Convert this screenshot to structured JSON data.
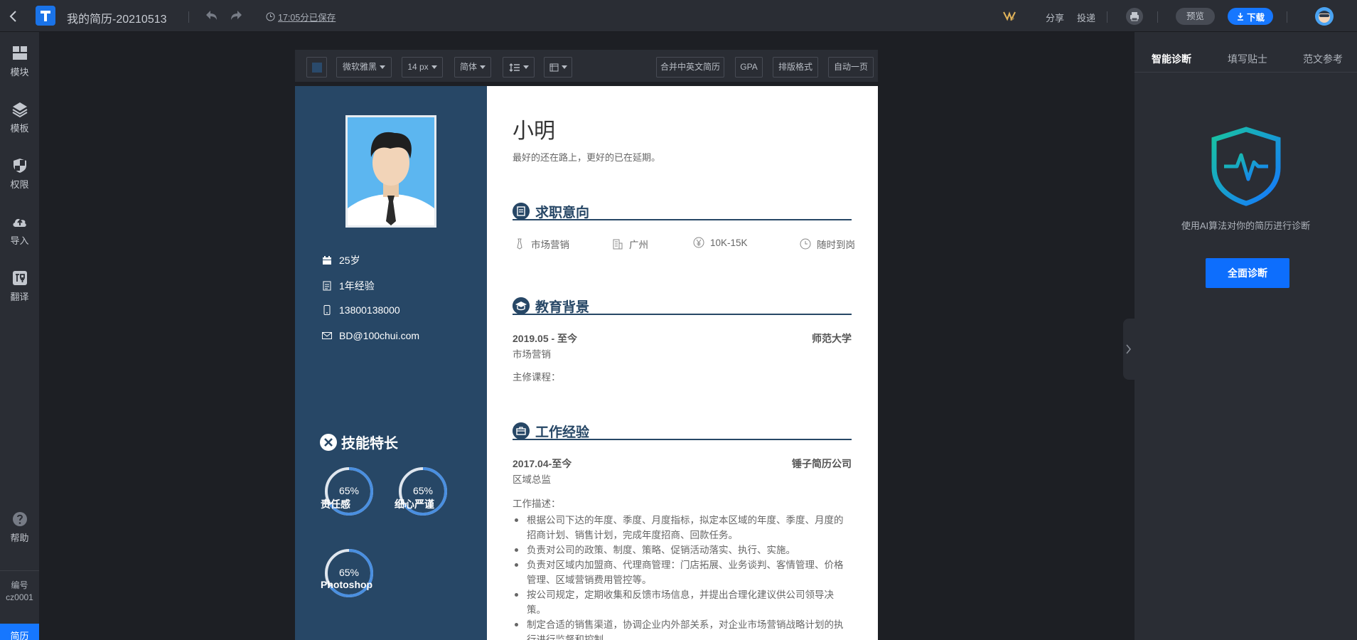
{
  "topbar": {
    "doc_title": "我的简历-20210513",
    "save_status": "17:05分已保存",
    "share": "分享",
    "deliver": "投递",
    "preview": "预览",
    "download": "下载"
  },
  "sidebar": {
    "items": [
      {
        "label": "模块",
        "icon": "blocks-icon"
      },
      {
        "label": "模板",
        "icon": "layers-icon"
      },
      {
        "label": "权限",
        "icon": "shield-icon"
      },
      {
        "label": "导入",
        "icon": "cloud-upload-icon"
      },
      {
        "label": "翻译",
        "icon": "translate-icon"
      }
    ],
    "help": "帮助",
    "number_label": "编号",
    "number_value": "cz0001",
    "resume_tab": "简历"
  },
  "editor_toolbar": {
    "font": "微软雅黑",
    "size": "14 px",
    "script": "简体",
    "merge": "合并中英文简历",
    "gpa": "GPA",
    "layout": "排版格式",
    "one_page": "自动一页"
  },
  "resume": {
    "name": "小明",
    "motto": "最好的还在路上，更好的已在延期。",
    "info": {
      "age": "25岁",
      "experience": "1年经验",
      "phone": "13800138000",
      "email": "BD@100chui.com"
    },
    "skills_title": "技能特长",
    "skills": [
      {
        "percent": "65%",
        "value": 0.65,
        "name": "责任感"
      },
      {
        "percent": "65%",
        "value": 0.65,
        "name": "细心严谨"
      },
      {
        "percent": "65%",
        "value": 0.65,
        "name": "Photoshop"
      }
    ],
    "intent": {
      "title": "求职意向",
      "job": "市场营销",
      "city": "广州",
      "salary": "10K-15K",
      "availability": "随时到岗"
    },
    "education": {
      "title": "教育背景",
      "period": "2019.05 - 至今",
      "school": "师范大学",
      "major": "市场营销",
      "courses": "主修课程："
    },
    "work": {
      "title": "工作经验",
      "period": "2017.04-至今",
      "company": "锤子简历公司",
      "position": "区域总监",
      "desc_label": "工作描述：",
      "duties": [
        "根据公司下达的年度、季度、月度指标，拟定本区域的年度、季度、月度的招商计划、销售计划，完成年度招商、回款任务。",
        "负责对公司的政策、制度、策略、促销活动落实、执行、实施。",
        "负责对区域内加盟商、代理商管理：门店拓展、业务谈判、客情管理、价格管理、区域营销费用管控等。",
        "按公司规定，定期收集和反馈市场信息，并提出合理化建议供公司领导决策。",
        "制定合适的销售渠道，协调企业内外部关系，对企业市场营销战略计划的执行进行监督和控制。"
      ]
    }
  },
  "right_panel": {
    "tabs": [
      "智能诊断",
      "填写贴士",
      "范文参考"
    ],
    "diag_text": "使用AI算法对你的简历进行诊断",
    "diag_button": "全面诊断"
  }
}
